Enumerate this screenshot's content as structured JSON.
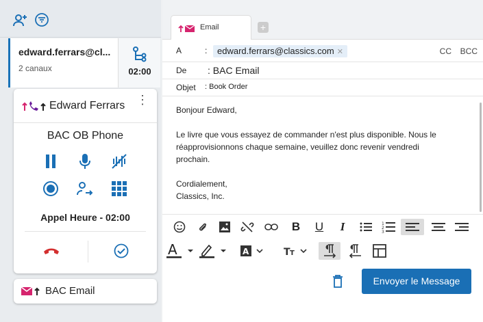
{
  "sidebar": {
    "contact": {
      "address": "edward.ferrars@cl...",
      "channels": "2 canaux",
      "timer": "02:00"
    },
    "phone": {
      "contact_name": "Edward Ferrars",
      "queue": "BAC OB Phone",
      "status_label": "Appel Heure - 02:00"
    },
    "email_item": {
      "label": "BAC Email"
    }
  },
  "composer": {
    "tab_label": "Email",
    "to_label": "A",
    "to_value": "edward.ferrars@classics.com",
    "cc_label": "CC",
    "bcc_label": "BCC",
    "from_label": "De",
    "from_value": ": BAC Email",
    "subject_label": "Objet",
    "subject_value": ": Book Order",
    "body": {
      "greeting": "Bonjour Edward,",
      "line1": "Le livre que vous essayez de commander n'est plus disponible. Nous le",
      "line2": "réapprovisionnons chaque semaine, veuillez donc revenir vendredi",
      "line3": "prochain.",
      "closing": "Cordialement,",
      "signature": "Classics, Inc."
    },
    "send_label": "Envoyer le Message"
  },
  "colors": {
    "accent": "#1a6fb5",
    "brand_pink": "#d6246e",
    "hangup_red": "#d32f2f"
  }
}
